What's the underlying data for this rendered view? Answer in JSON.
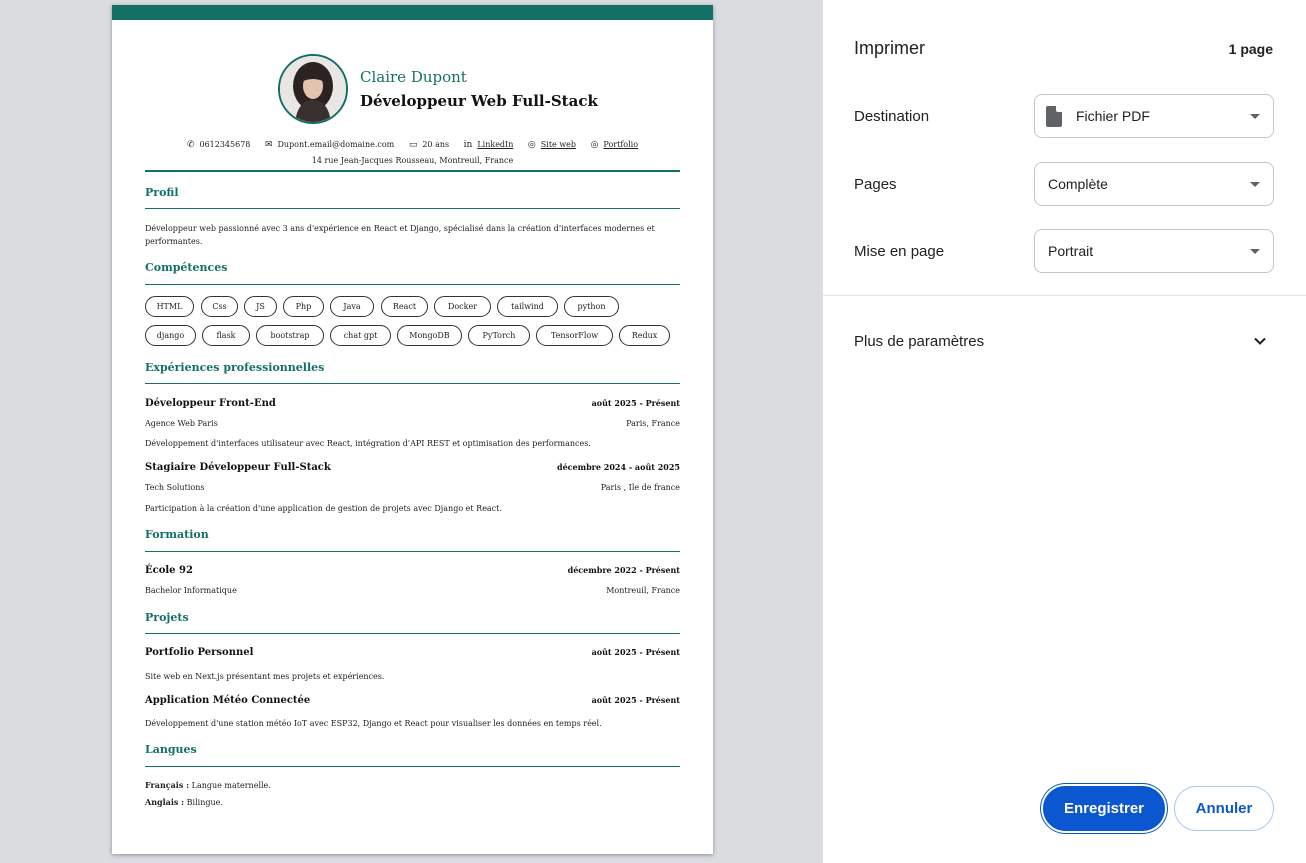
{
  "dialog": {
    "title": "Imprimer",
    "page_count": "1 page",
    "destination": {
      "label": "Destination",
      "value": "Fichier PDF"
    },
    "pages": {
      "label": "Pages",
      "value": "Complète"
    },
    "layout": {
      "label": "Mise en page",
      "value": "Portrait"
    },
    "more_settings": "Plus de paramètres",
    "save_button": "Enregistrer",
    "cancel_button": "Annuler"
  },
  "resume": {
    "name": "Claire Dupont",
    "role": "Développeur Web Full-Stack",
    "contact": {
      "phone": "0612345678",
      "email": "Dupont.email@domaine.com",
      "age": "20 ans",
      "linkedin": "LinkedIn",
      "site": "Site web",
      "portfolio": "Portfolio",
      "address": "14 rue Jean-Jacques Rousseau, Montreuil, France"
    },
    "profile": {
      "heading": "Profil",
      "text": "Développeur web passionné avec 3 ans d'expérience en React et Django, spécialisé dans la création d'interfaces modernes et performantes."
    },
    "skills": {
      "heading": "Compétences",
      "items": [
        "HTML",
        "Css",
        "JS",
        "Php",
        "Java",
        "React",
        "Docker",
        "tailwind",
        "python",
        "django",
        "flask",
        "bootstrap",
        "chat gpt",
        "MongoDB",
        "PyTorch",
        "TensorFlow",
        "Redux"
      ]
    },
    "experience": {
      "heading": "Expériences professionnelles",
      "jobs": [
        {
          "title": "Développeur Front-End",
          "dates": "août 2025 - Présent",
          "company": "Agence Web Paris",
          "location": "Paris, France",
          "desc": "Développement d'interfaces utilisateur avec React, intégration d'API REST et optimisation des performances."
        },
        {
          "title": "Stagiaire Développeur Full-Stack",
          "dates": "décembre 2024 - août 2025",
          "company": "Tech Solutions",
          "location": "Paris , Ile de france",
          "desc": "Participation à la création d'une application de gestion de projets avec Django et React."
        }
      ]
    },
    "education": {
      "heading": "Formation",
      "items": [
        {
          "school": "École 92",
          "dates": "décembre 2022 - Présent",
          "degree": "Bachelor Informatique",
          "location": "Montreuil, France"
        }
      ]
    },
    "projects": {
      "heading": "Projets",
      "items": [
        {
          "title": "Portfolio Personnel",
          "dates": "août 2025 - Présent",
          "desc": "Site web en Next.js présentant mes projets et expériences."
        },
        {
          "title": "Application Météo Connectée",
          "dates": "août 2025 - Présent",
          "desc": "Développement d'une station météo IoT avec ESP32, Django et React pour visualiser les données en temps réel."
        }
      ]
    },
    "languages": {
      "heading": "Langues",
      "items": [
        {
          "name": "Français :",
          "level": "Langue maternelle."
        },
        {
          "name": "Anglais :",
          "level": "Bilingue."
        }
      ]
    }
  },
  "colors": {
    "accent": "#147066",
    "primary_button": "#0b57d0",
    "preview_bg": "#dadce0"
  },
  "icons": [
    "document-icon",
    "dropdown-caret-icon",
    "chevron-down-icon",
    "phone-icon",
    "mail-icon",
    "calendar-icon",
    "linkedin-icon",
    "globe-icon"
  ]
}
